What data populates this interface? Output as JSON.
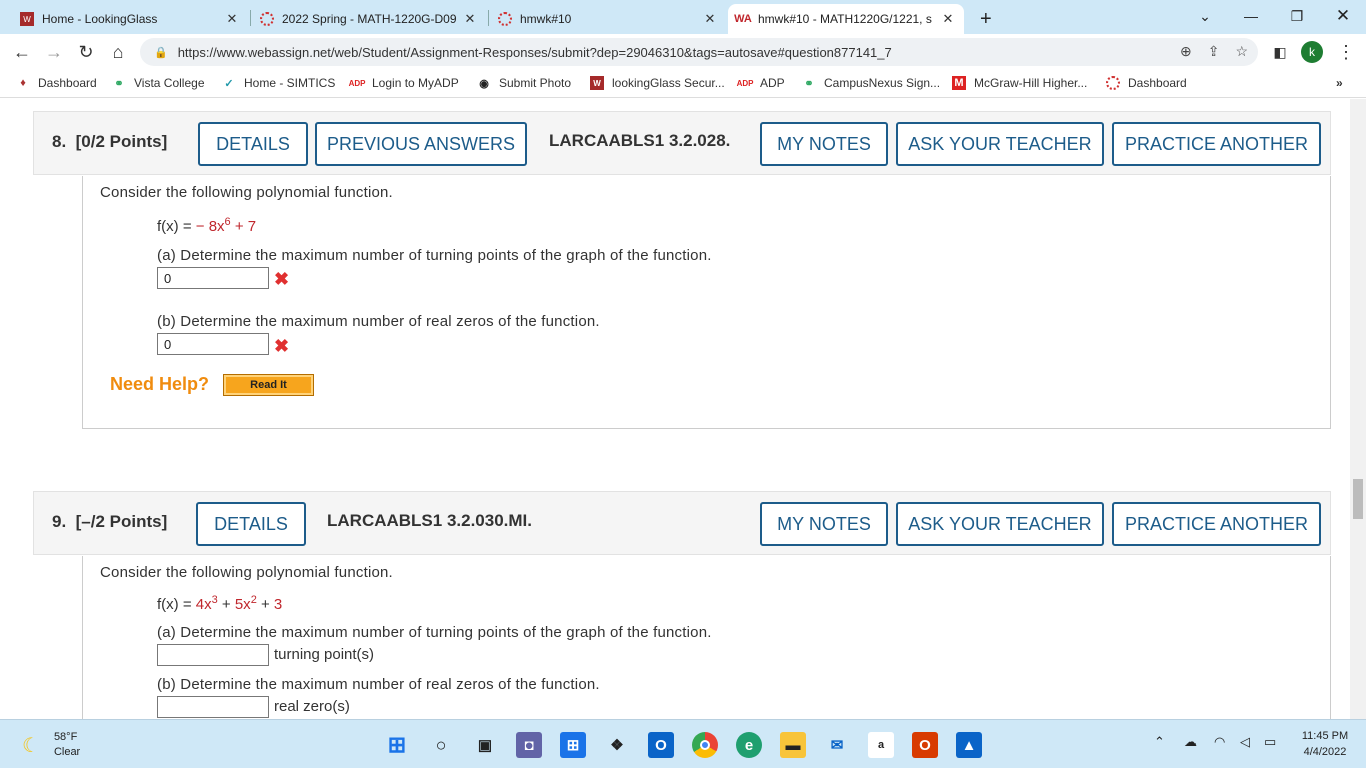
{
  "browser": {
    "tabs": [
      {
        "title": "Home - LookingGlass"
      },
      {
        "title": "2022 Spring - MATH-1220G-D09"
      },
      {
        "title": "hmwk#10"
      },
      {
        "title": "hmwk#10 - MATH1220G/1221, s"
      }
    ],
    "new_tab_symbol": "+",
    "url": "https://www.webassign.net/web/Student/Assignment-Responses/submit?dep=29046310&tags=autosave#question877141_7",
    "profile_initial": "k",
    "bookmarks": [
      {
        "label": "Dashboard",
        "icon": "bookmark-icon"
      },
      {
        "label": "Vista College",
        "icon": "vista-icon"
      },
      {
        "label": "Home - SIMTICS",
        "icon": "simtics-icon"
      },
      {
        "label": "Login to MyADP",
        "icon": "adp-icon"
      },
      {
        "label": "Submit Photo",
        "icon": "photo-icon"
      },
      {
        "label": "lookingGlass Secur...",
        "icon": "lookingglass-icon"
      },
      {
        "label": "ADP",
        "icon": "adp-icon"
      },
      {
        "label": "CampusNexus Sign...",
        "icon": "campusnexus-icon"
      },
      {
        "label": "McGraw-Hill Higher...",
        "icon": "mcgraw-icon"
      },
      {
        "label": "Dashboard",
        "icon": "dashboard-icon"
      }
    ],
    "more_bookmarks": "»"
  },
  "questions": [
    {
      "number": "8.",
      "points": "[0/2 Points]",
      "buttons": {
        "details": "DETAILS",
        "previous": "PREVIOUS ANSWERS",
        "notes": "MY NOTES",
        "ask": "ASK YOUR TEACHER",
        "practice": "PRACTICE ANOTHER"
      },
      "reference": "LARCAABLS1 3.2.028.",
      "prompt": "Consider the following polynomial function.",
      "function": {
        "lhs": "f(x) = ",
        "rhs_a": "− 8x",
        "exp_a": "6",
        "rhs_b": " + 7"
      },
      "part_a": "(a) Determine the maximum number of turning points of the graph of the function.",
      "answer_a": "0",
      "part_b": "(b) Determine the maximum number of real zeros of the function.",
      "answer_b": "0",
      "need_help": "Need Help?",
      "read_it": "Read It"
    },
    {
      "number": "9.",
      "points": "[–/2 Points]",
      "buttons": {
        "details": "DETAILS",
        "notes": "MY NOTES",
        "ask": "ASK YOUR TEACHER",
        "practice": "PRACTICE ANOTHER"
      },
      "reference": "LARCAABLS1 3.2.030.MI.",
      "prompt": "Consider the following polynomial function.",
      "function": {
        "lhs": "f(x) = ",
        "t1": "4x",
        "e1": "3",
        "plus1": " + ",
        "t2": "5x",
        "e2": "2",
        "plus2": " + ",
        "t3": "3"
      },
      "part_a": "(a) Determine the maximum number of turning points of the graph of the function.",
      "unit_a": "turning point(s)",
      "part_b": "(b) Determine the maximum number of real zeros of the function.",
      "unit_b": "real zero(s)"
    }
  ],
  "taskbar": {
    "weather_temp": "58°F",
    "weather_desc": "Clear",
    "time": "11:45 PM",
    "date": "4/4/2022"
  },
  "colors": {
    "button_blue": "#1d5c8a",
    "error_red": "#e03030",
    "help_orange": "#f08c0f",
    "function_red": "#c0272d"
  }
}
